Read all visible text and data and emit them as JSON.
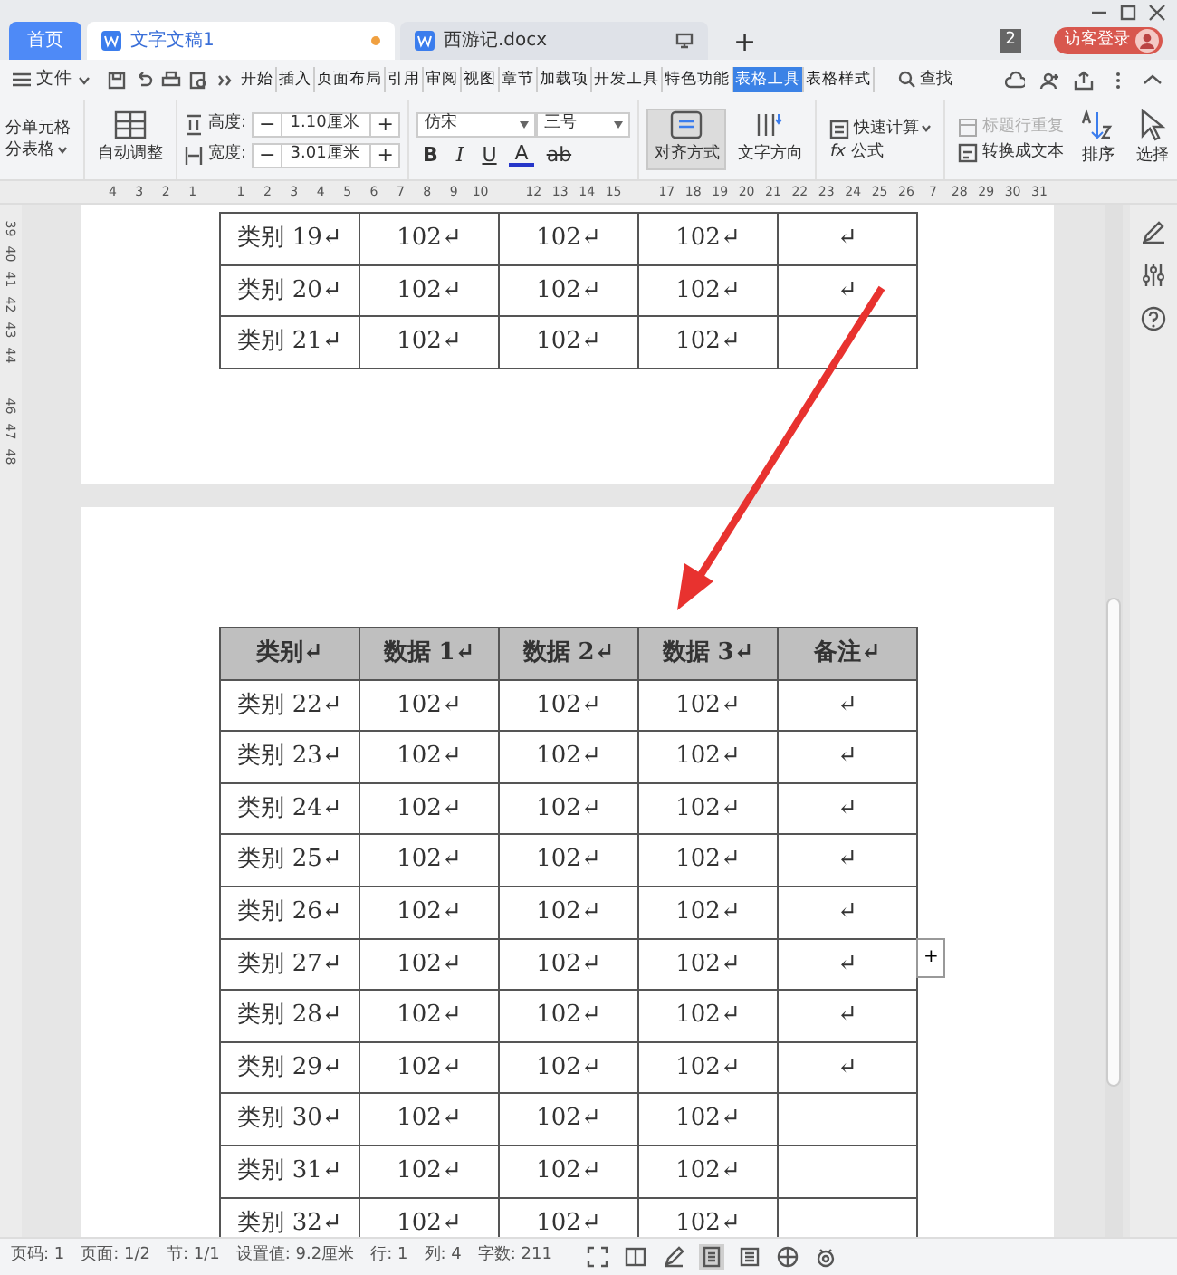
{
  "tabs": [
    {
      "label": "首页",
      "kind": "home",
      "selected": false
    },
    {
      "label": "文字文稿1",
      "kind": "doc",
      "selected": true,
      "unsaved": true
    },
    {
      "label": "西游记.docx",
      "kind": "doc",
      "selected": false,
      "unsaved": false
    }
  ],
  "new_tab": "+",
  "window_count": "2",
  "login": "访客登录",
  "menu": {
    "file": "文件",
    "tabs": [
      {
        "label": "开始",
        "selected": false
      },
      {
        "label": "插入",
        "selected": false
      },
      {
        "label": "页面布局",
        "selected": false
      },
      {
        "label": "引用",
        "selected": false
      },
      {
        "label": "审阅",
        "selected": false
      },
      {
        "label": "视图",
        "selected": false
      },
      {
        "label": "章节",
        "selected": false
      },
      {
        "label": "加载项",
        "selected": false
      },
      {
        "label": "开发工具",
        "selected": false
      },
      {
        "label": "特色功能",
        "selected": false
      },
      {
        "label": "表格工具",
        "selected": true
      },
      {
        "label": "表格样式",
        "selected": false
      }
    ],
    "search": "查找"
  },
  "ribbon": {
    "split_cells": "分单元格",
    "split_table": "分表格",
    "auto_fit": "自动调整",
    "height_label": "高度:",
    "height_value": "1.10厘米",
    "width_label": "宽度:",
    "width_value": "3.01厘米",
    "minus": "−",
    "plus": "+",
    "font": "仿宋",
    "size": "三号",
    "bold": "B",
    "italic": "I",
    "underline": "U",
    "font_color": "A",
    "char_style": "ab",
    "align": {
      "label": "对齐方式",
      "selected": true
    },
    "text_direction": "文字方向",
    "quick_calc": "快速计算",
    "repeat_header": {
      "label": "标题行重复",
      "disabled": true
    },
    "formula_fx": "fx",
    "formula": "公式",
    "to_text": "转换成文本",
    "sort": "排序",
    "select": "选择"
  },
  "ruler": [
    "4",
    "3",
    "2",
    "1",
    "1",
    "2",
    "3",
    "4",
    "5",
    "6",
    "7",
    "8",
    "9",
    "10",
    "12",
    "13",
    "14",
    "15",
    "17",
    "18",
    "19",
    "20",
    "21",
    "22",
    "23",
    "24",
    "25",
    "26",
    "7",
    "28",
    "29",
    "30",
    "31"
  ],
  "vertical_ruler": [
    "39",
    "40",
    "41",
    "42",
    "43",
    "44",
    "46",
    "47",
    "48"
  ],
  "page_1_table": {
    "rows": [
      {
        "cells": [
          "类别 19↵",
          "102↵",
          "102↵",
          "102↵",
          "↵"
        ]
      },
      {
        "cells": [
          "类别 20↵",
          "102↵",
          "102↵",
          "102↵",
          "↵"
        ]
      },
      {
        "cells": [
          "类别 21↵",
          "102↵",
          "102↵",
          "102↵"
        ]
      }
    ]
  },
  "page_2_table": {
    "columns": [
      "类别↵",
      "数据 1↵",
      "数据 2↵",
      "数据 3↵",
      "备注↵"
    ],
    "rows": [
      {
        "cells": [
          "类别 22↵",
          "102↵",
          "102↵",
          "102↵",
          "↵"
        ]
      },
      {
        "cells": [
          "类别 23↵",
          "102↵",
          "102↵",
          "102↵",
          "↵"
        ]
      },
      {
        "cells": [
          "类别 24↵",
          "102↵",
          "102↵",
          "102↵",
          "↵"
        ]
      },
      {
        "cells": [
          "类别 25↵",
          "102↵",
          "102↵",
          "102↵",
          "↵"
        ]
      },
      {
        "cells": [
          "类别 26↵",
          "102↵",
          "102↵",
          "102↵",
          "↵"
        ]
      },
      {
        "cells": [
          "类别 27↵",
          "102↵",
          "102↵",
          "102↵",
          "↵"
        ]
      },
      {
        "cells": [
          "类别 28↵",
          "102↵",
          "102↵",
          "102↵",
          "↵"
        ]
      },
      {
        "cells": [
          "类别 29↵",
          "102↵",
          "102↵",
          "102↵",
          "↵"
        ]
      },
      {
        "cells": [
          "类别 30↵",
          "102↵",
          "102↵",
          "102↵"
        ]
      },
      {
        "cells": [
          "类别 31↵",
          "102↵",
          "102↵",
          "102↵"
        ]
      },
      {
        "cells": [
          "类别 32↵",
          "102↵",
          "102↵",
          "102↵"
        ]
      }
    ]
  },
  "add_column": "+",
  "status_bar": {
    "items": [
      "页码: 1",
      "页面: 1/2",
      "节: 1/1",
      "设置值: 9.2厘米",
      "行: 1",
      "列: 4",
      "字数: 211"
    ],
    "views": [
      {
        "kind": "fullscreen",
        "selected": false
      },
      {
        "kind": "read",
        "selected": false
      },
      {
        "kind": "write",
        "selected": false
      },
      {
        "kind": "page",
        "selected": true
      },
      {
        "kind": "outline",
        "selected": false
      },
      {
        "kind": "web",
        "selected": false
      },
      {
        "kind": "eye",
        "selected": false
      }
    ]
  }
}
